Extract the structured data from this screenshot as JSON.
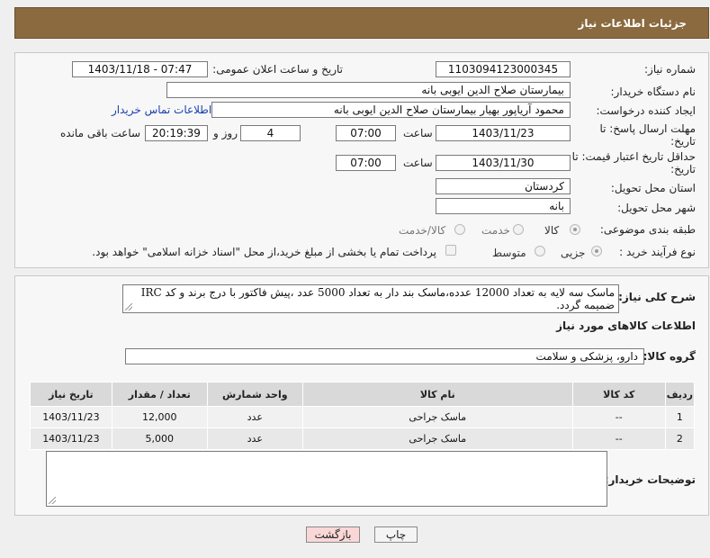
{
  "header": {
    "title": "جزئیات اطلاعات نیاز"
  },
  "form": {
    "need_number_label": "شماره نیاز:",
    "need_number": "1103094123000345",
    "announce_label": "تاریخ و ساعت اعلان عمومی:",
    "announce_value": "1403/11/18 - 07:47",
    "buyer_org_label": "نام دستگاه خریدار:",
    "buyer_org": "بیمارستان صلاح الدین ایوبی بانه",
    "creator_label": "ایجاد کننده درخواست:",
    "creator": "محمود آریاپور بهیار بیمارستان صلاح الدین ایوبی بانه",
    "contact_link": "اطلاعات تماس خریدار",
    "deadline_label": "مهلت ارسال پاسخ: تا تاریخ:",
    "deadline_date": "1403/11/23",
    "time_label": "ساعت",
    "deadline_time": "07:00",
    "days_value": "4",
    "days_label": "روز و",
    "remaining_time": "20:19:39",
    "remaining_label": "ساعت باقی مانده",
    "validity_label": "حداقل تاریخ اعتبار قیمت: تا تاریخ:",
    "validity_date": "1403/11/30",
    "validity_time": "07:00",
    "province_label": "استان محل تحویل:",
    "province": "کردستان",
    "city_label": "شهر محل تحویل:",
    "city": "بانه",
    "category_label": "طبقه بندی موضوعی:",
    "category_options": [
      "کالا",
      "خدمت",
      "کالا/خدمت"
    ],
    "process_label": "نوع فرآیند خرید :",
    "process_options": [
      "جزیی",
      "متوسط"
    ],
    "payment_note": "پرداخت تمام یا بخشی از مبلغ خرید،از محل \"اسناد خزانه اسلامی\" خواهد بود."
  },
  "summary": {
    "label": "شرح کلی نیاز:",
    "text": "ماسک سه لایه به تعداد 12000 عدده،ماسک بند دار به تعداد 5000 عدد ،پیش فاکتور با درج برند و کد IRC ضمیمه گردد.",
    "goods_info_title": "اطلاعات کالاهای مورد نیاز",
    "group_label": "گروه کالا:",
    "group_value": "دارو، پزشکی و سلامت"
  },
  "table": {
    "headers": [
      "ردیف",
      "کد کالا",
      "نام کالا",
      "واحد شمارش",
      "تعداد / مقدار",
      "تاریخ نیاز"
    ],
    "rows": [
      [
        "1",
        "--",
        "ماسک جراحی",
        "عدد",
        "12,000",
        "1403/11/23"
      ],
      [
        "2",
        "--",
        "ماسک جراحی",
        "عدد",
        "5,000",
        "1403/11/23"
      ]
    ]
  },
  "buyer_notes_label": "توضیحات خریدار:",
  "buttons": {
    "print": "چاپ",
    "back": "بازگشت"
  },
  "colors": {
    "header_bg": "#8b6a3f",
    "link": "#1a3fb0",
    "back_button_bg": "#f9d7d7"
  }
}
